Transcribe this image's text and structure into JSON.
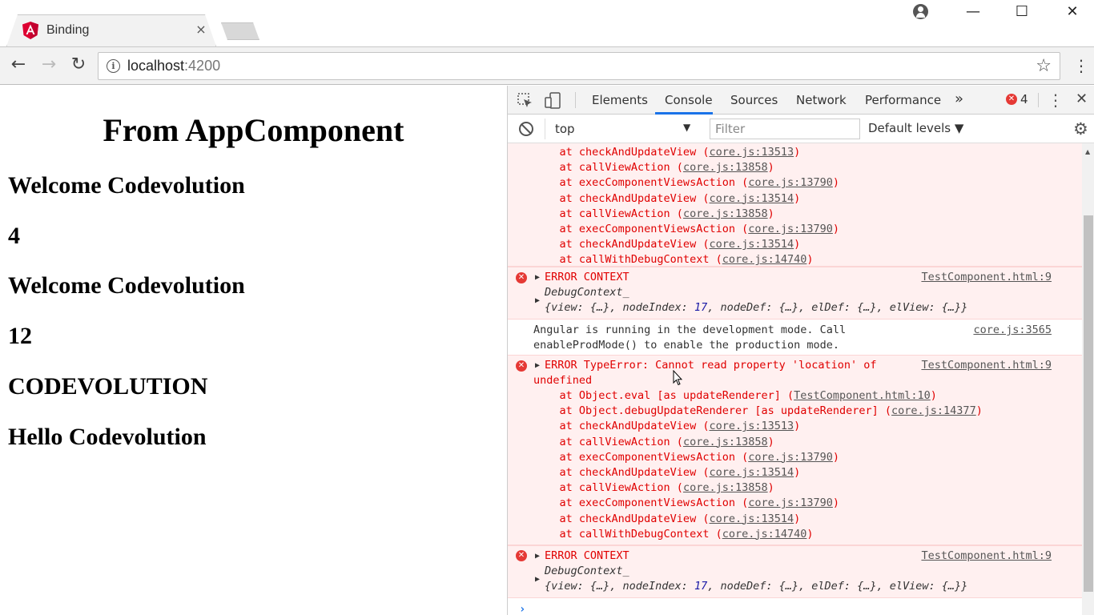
{
  "browser": {
    "tab_title": "Binding",
    "tab_close": "×",
    "url_host": "localhost",
    "url_port": ":4200",
    "icons": [
      "angular-logo-icon",
      "back-icon",
      "forward-icon",
      "reload-icon",
      "info-icon",
      "star-icon",
      "menu-icon",
      "profile-icon"
    ],
    "window_controls": {
      "minimize": "—",
      "maximize": "☐",
      "close": "✕"
    }
  },
  "page": {
    "heading": "From AppComponent",
    "lines": [
      "Welcome Codevolution",
      "4",
      "Welcome Codevolution",
      "12",
      "CODEVOLUTION",
      "Hello Codevolution"
    ]
  },
  "devtools": {
    "tabs": [
      "Elements",
      "Console",
      "Sources",
      "Network",
      "Performance"
    ],
    "active_tab": "Console",
    "more_tabs": "»",
    "error_count": "4",
    "context": "top",
    "filter_placeholder": "Filter",
    "levels": "Default levels ▼",
    "colors": {
      "error_text": "#e00000",
      "error_bg": "#fff0f0",
      "accent": "#1a73e8"
    }
  },
  "console": {
    "stack1": [
      {
        "prefix": "    at checkAndUpdateView (",
        "link": "core.js:13513",
        "suffix": ")"
      },
      {
        "prefix": "    at callViewAction (",
        "link": "core.js:13858",
        "suffix": ")"
      },
      {
        "prefix": "    at execComponentViewsAction (",
        "link": "core.js:13790",
        "suffix": ")"
      },
      {
        "prefix": "    at checkAndUpdateView (",
        "link": "core.js:13514",
        "suffix": ")"
      },
      {
        "prefix": "    at callViewAction (",
        "link": "core.js:13858",
        "suffix": ")"
      },
      {
        "prefix": "    at execComponentViewsAction (",
        "link": "core.js:13790",
        "suffix": ")"
      },
      {
        "prefix": "    at checkAndUpdateView (",
        "link": "core.js:13514",
        "suffix": ")"
      },
      {
        "prefix": "    at callWithDebugContext (",
        "link": "core.js:14740",
        "suffix": ")"
      }
    ],
    "ctx1": {
      "title": "ERROR CONTEXT",
      "source": "TestComponent.html:9",
      "obj_name": "DebugContext_",
      "obj_pre": "{view: {…}, nodeIndex: ",
      "obj_num": "17",
      "obj_post": ", nodeDef: {…}, elDef: {…}, elView: {…}}"
    },
    "info": {
      "line1": "Angular is running in the development mode. Call",
      "line2": "enableProdMode() to enable the production mode.",
      "source": "core.js:3565"
    },
    "error2": {
      "title": "ERROR TypeError: Cannot read property 'location' of",
      "title2": "undefined",
      "source": "TestComponent.html:9",
      "stack": [
        {
          "prefix": "    at Object.eval [as updateRenderer] (",
          "link": "TestComponent.html:10",
          "suffix": ")"
        },
        {
          "prefix": "    at Object.debugUpdateRenderer [as updateRenderer] (",
          "link": "core.js:14377",
          "suffix": ")"
        },
        {
          "prefix": "    at checkAndUpdateView (",
          "link": "core.js:13513",
          "suffix": ")"
        },
        {
          "prefix": "    at callViewAction (",
          "link": "core.js:13858",
          "suffix": ")"
        },
        {
          "prefix": "    at execComponentViewsAction (",
          "link": "core.js:13790",
          "suffix": ")"
        },
        {
          "prefix": "    at checkAndUpdateView (",
          "link": "core.js:13514",
          "suffix": ")"
        },
        {
          "prefix": "    at callViewAction (",
          "link": "core.js:13858",
          "suffix": ")"
        },
        {
          "prefix": "    at execComponentViewsAction (",
          "link": "core.js:13790",
          "suffix": ")"
        },
        {
          "prefix": "    at checkAndUpdateView (",
          "link": "core.js:13514",
          "suffix": ")"
        },
        {
          "prefix": "    at callWithDebugContext (",
          "link": "core.js:14740",
          "suffix": ")"
        }
      ]
    },
    "ctx2": {
      "title": "ERROR CONTEXT",
      "source": "TestComponent.html:9",
      "obj_name": "DebugContext_",
      "obj_pre": "{view: {…}, nodeIndex: ",
      "obj_num": "17",
      "obj_post": ", nodeDef: {…}, elDef: {…}, elView: {…}}"
    },
    "prompt": "›"
  }
}
